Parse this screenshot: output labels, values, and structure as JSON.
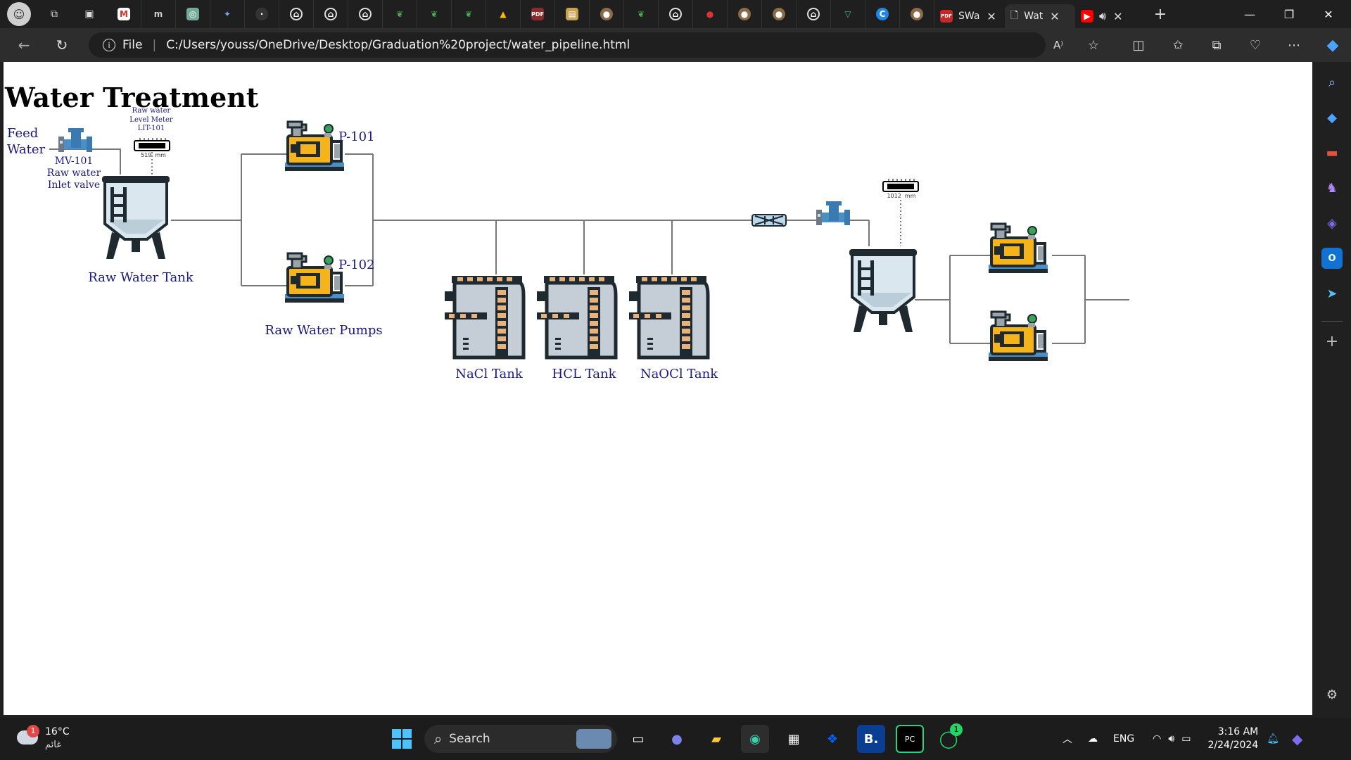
{
  "browser": {
    "tabs": [
      {
        "label": "SWa",
        "icon": "pdf-icon"
      },
      {
        "label": "Wat",
        "icon": "page-icon"
      },
      {
        "label": "",
        "icon": "youtube-icon"
      }
    ],
    "url_scheme": "File",
    "url": "C:/Users/youss/OneDrive/Desktop/Graduation%20project/water_pipeline.html"
  },
  "page": {
    "title": "Water Treatment",
    "feed_water": [
      "Feed",
      "Water"
    ],
    "valve_label": [
      "MV-101",
      "Raw water",
      "Inlet valve"
    ],
    "level_meter_label": [
      "Raw water",
      "Level Meter",
      "LIT-101"
    ],
    "level_meter_value": "519",
    "level_meter_unit": "mm",
    "raw_tank_label": "Raw Water Tank",
    "pump1_label": "P-101",
    "pump2_label": "P-102",
    "pumps_label": "Raw Water Pumps",
    "chem_tanks": [
      "NaCl Tank",
      "HCL Tank",
      "NaOCl Tank"
    ],
    "meter2_value": "1012",
    "meter2_unit": "mm"
  },
  "taskbar": {
    "weather_temp": "16°C",
    "weather_desc": "غائم",
    "weather_badge": "1",
    "search_placeholder": "Search",
    "whatsapp_badge": "1",
    "lang": "ENG",
    "time": "3:16 AM",
    "date": "2/24/2024"
  },
  "colors": {
    "pump_yellow": "#f4b41a",
    "tank_body": "#dbe7ee",
    "pipe": "#777777",
    "label_blue": "#1a1a80",
    "valve_blue": "#4a90c8"
  }
}
